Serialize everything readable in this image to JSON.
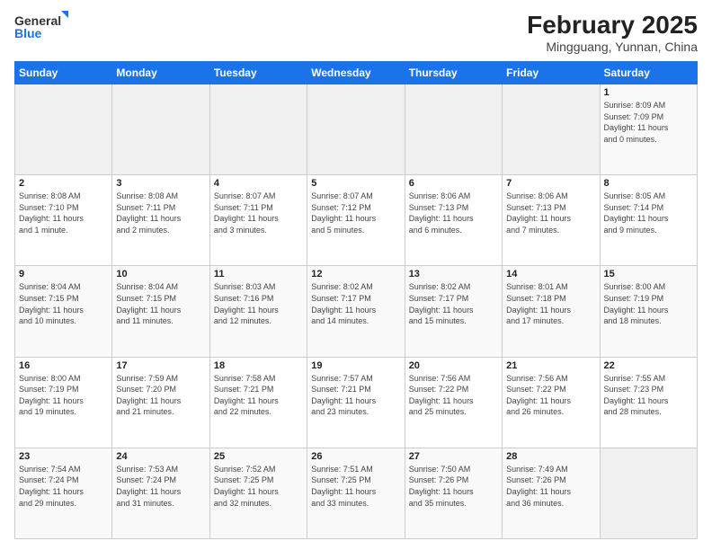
{
  "header": {
    "logo_general": "General",
    "logo_blue": "Blue",
    "title": "February 2025",
    "subtitle": "Mingguang, Yunnan, China"
  },
  "calendar": {
    "days_of_week": [
      "Sunday",
      "Monday",
      "Tuesday",
      "Wednesday",
      "Thursday",
      "Friday",
      "Saturday"
    ],
    "weeks": [
      [
        {
          "day": "",
          "info": ""
        },
        {
          "day": "",
          "info": ""
        },
        {
          "day": "",
          "info": ""
        },
        {
          "day": "",
          "info": ""
        },
        {
          "day": "",
          "info": ""
        },
        {
          "day": "",
          "info": ""
        },
        {
          "day": "1",
          "info": "Sunrise: 8:09 AM\nSunset: 7:09 PM\nDaylight: 11 hours\nand 0 minutes."
        }
      ],
      [
        {
          "day": "2",
          "info": "Sunrise: 8:08 AM\nSunset: 7:10 PM\nDaylight: 11 hours\nand 1 minute."
        },
        {
          "day": "3",
          "info": "Sunrise: 8:08 AM\nSunset: 7:11 PM\nDaylight: 11 hours\nand 2 minutes."
        },
        {
          "day": "4",
          "info": "Sunrise: 8:07 AM\nSunset: 7:11 PM\nDaylight: 11 hours\nand 3 minutes."
        },
        {
          "day": "5",
          "info": "Sunrise: 8:07 AM\nSunset: 7:12 PM\nDaylight: 11 hours\nand 5 minutes."
        },
        {
          "day": "6",
          "info": "Sunrise: 8:06 AM\nSunset: 7:13 PM\nDaylight: 11 hours\nand 6 minutes."
        },
        {
          "day": "7",
          "info": "Sunrise: 8:06 AM\nSunset: 7:13 PM\nDaylight: 11 hours\nand 7 minutes."
        },
        {
          "day": "8",
          "info": "Sunrise: 8:05 AM\nSunset: 7:14 PM\nDaylight: 11 hours\nand 9 minutes."
        }
      ],
      [
        {
          "day": "9",
          "info": "Sunrise: 8:04 AM\nSunset: 7:15 PM\nDaylight: 11 hours\nand 10 minutes."
        },
        {
          "day": "10",
          "info": "Sunrise: 8:04 AM\nSunset: 7:15 PM\nDaylight: 11 hours\nand 11 minutes."
        },
        {
          "day": "11",
          "info": "Sunrise: 8:03 AM\nSunset: 7:16 PM\nDaylight: 11 hours\nand 12 minutes."
        },
        {
          "day": "12",
          "info": "Sunrise: 8:02 AM\nSunset: 7:17 PM\nDaylight: 11 hours\nand 14 minutes."
        },
        {
          "day": "13",
          "info": "Sunrise: 8:02 AM\nSunset: 7:17 PM\nDaylight: 11 hours\nand 15 minutes."
        },
        {
          "day": "14",
          "info": "Sunrise: 8:01 AM\nSunset: 7:18 PM\nDaylight: 11 hours\nand 17 minutes."
        },
        {
          "day": "15",
          "info": "Sunrise: 8:00 AM\nSunset: 7:19 PM\nDaylight: 11 hours\nand 18 minutes."
        }
      ],
      [
        {
          "day": "16",
          "info": "Sunrise: 8:00 AM\nSunset: 7:19 PM\nDaylight: 11 hours\nand 19 minutes."
        },
        {
          "day": "17",
          "info": "Sunrise: 7:59 AM\nSunset: 7:20 PM\nDaylight: 11 hours\nand 21 minutes."
        },
        {
          "day": "18",
          "info": "Sunrise: 7:58 AM\nSunset: 7:21 PM\nDaylight: 11 hours\nand 22 minutes."
        },
        {
          "day": "19",
          "info": "Sunrise: 7:57 AM\nSunset: 7:21 PM\nDaylight: 11 hours\nand 23 minutes."
        },
        {
          "day": "20",
          "info": "Sunrise: 7:56 AM\nSunset: 7:22 PM\nDaylight: 11 hours\nand 25 minutes."
        },
        {
          "day": "21",
          "info": "Sunrise: 7:56 AM\nSunset: 7:22 PM\nDaylight: 11 hours\nand 26 minutes."
        },
        {
          "day": "22",
          "info": "Sunrise: 7:55 AM\nSunset: 7:23 PM\nDaylight: 11 hours\nand 28 minutes."
        }
      ],
      [
        {
          "day": "23",
          "info": "Sunrise: 7:54 AM\nSunset: 7:24 PM\nDaylight: 11 hours\nand 29 minutes."
        },
        {
          "day": "24",
          "info": "Sunrise: 7:53 AM\nSunset: 7:24 PM\nDaylight: 11 hours\nand 31 minutes."
        },
        {
          "day": "25",
          "info": "Sunrise: 7:52 AM\nSunset: 7:25 PM\nDaylight: 11 hours\nand 32 minutes."
        },
        {
          "day": "26",
          "info": "Sunrise: 7:51 AM\nSunset: 7:25 PM\nDaylight: 11 hours\nand 33 minutes."
        },
        {
          "day": "27",
          "info": "Sunrise: 7:50 AM\nSunset: 7:26 PM\nDaylight: 11 hours\nand 35 minutes."
        },
        {
          "day": "28",
          "info": "Sunrise: 7:49 AM\nSunset: 7:26 PM\nDaylight: 11 hours\nand 36 minutes."
        },
        {
          "day": "",
          "info": ""
        }
      ]
    ]
  }
}
